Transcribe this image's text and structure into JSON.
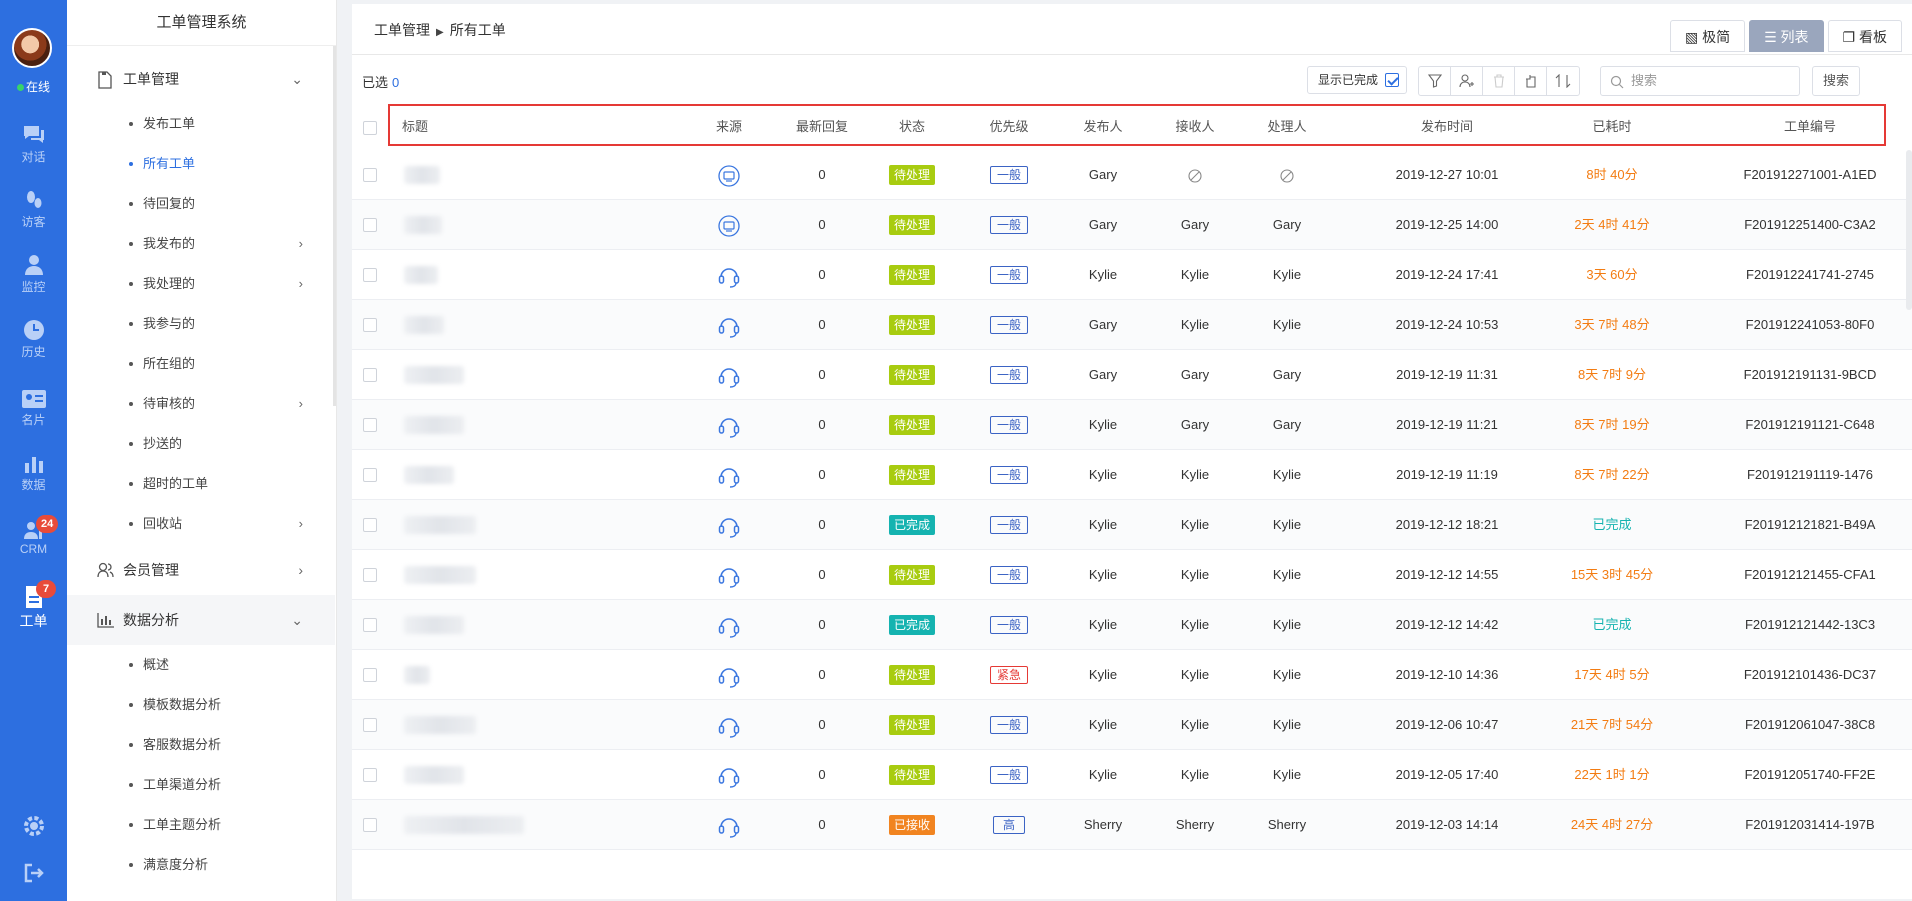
{
  "rail": {
    "online": "在线",
    "items": [
      {
        "label": "对话",
        "icon": "chat-icon"
      },
      {
        "label": "访客",
        "icon": "footprint-icon"
      },
      {
        "label": "监控",
        "icon": "monitor-person-icon"
      },
      {
        "label": "历史",
        "icon": "clock-icon"
      },
      {
        "label": "名片",
        "icon": "card-icon"
      },
      {
        "label": "数据",
        "icon": "bar-chart-icon"
      },
      {
        "label": "CRM",
        "icon": "crm-icon",
        "badge": "24"
      },
      {
        "label": "工单",
        "icon": "ticket-icon",
        "badge": "7"
      }
    ]
  },
  "nav": {
    "title": "工单管理系统",
    "ticket_group": "工单管理",
    "ticket_items": [
      "发布工单",
      "所有工单",
      "待回复的",
      "我发布的",
      "我处理的",
      "我参与的",
      "所在组的",
      "待审核的",
      "抄送的",
      "超时的工单",
      "回收站"
    ],
    "member_group": "会员管理",
    "analysis_group": "数据分析",
    "analysis_items": [
      "概述",
      "模板数据分析",
      "客服数据分析",
      "工单渠道分析",
      "工单主题分析",
      "满意度分析"
    ]
  },
  "header": {
    "breadcrumb_parent": "工单管理",
    "breadcrumb_current": "所有工单",
    "views": [
      "极简",
      "列表",
      "看板"
    ]
  },
  "toolbar": {
    "selected_label": "已选",
    "selected_count": "0",
    "show_done": "显示已完成",
    "search_placeholder": "搜索",
    "search_button": "搜索"
  },
  "columns": [
    "标题",
    "来源",
    "最新回复",
    "状态",
    "优先级",
    "发布人",
    "接收人",
    "处理人",
    "发布时间",
    "已耗时",
    "工单编号"
  ],
  "rows": [
    {
      "src": "web",
      "reply": "0",
      "status": "待处理",
      "prio": "一般",
      "pub": "Gary",
      "recv": "",
      "handler": "",
      "time": "2019-12-27 10:01",
      "elapsed": "8时 40分",
      "id": "F201912271001-A1ED"
    },
    {
      "src": "web",
      "reply": "0",
      "status": "待处理",
      "prio": "一般",
      "pub": "Gary",
      "recv": "Gary",
      "handler": "Gary",
      "time": "2019-12-25 14:00",
      "elapsed": "2天 4时 41分",
      "id": "F201912251400-C3A2"
    },
    {
      "src": "headset",
      "reply": "0",
      "status": "待处理",
      "prio": "一般",
      "pub": "Kylie",
      "recv": "Kylie",
      "handler": "Kylie",
      "time": "2019-12-24 17:41",
      "elapsed": "3天 60分",
      "id": "F201912241741-2745"
    },
    {
      "src": "headset",
      "reply": "0",
      "status": "待处理",
      "prio": "一般",
      "pub": "Gary",
      "recv": "Kylie",
      "handler": "Kylie",
      "time": "2019-12-24 10:53",
      "elapsed": "3天 7时 48分",
      "id": "F201912241053-80F0"
    },
    {
      "src": "headset",
      "reply": "0",
      "status": "待处理",
      "prio": "一般",
      "pub": "Gary",
      "recv": "Gary",
      "handler": "Gary",
      "time": "2019-12-19 11:31",
      "elapsed": "8天 7时 9分",
      "id": "F201912191131-9BCD"
    },
    {
      "src": "headset",
      "reply": "0",
      "status": "待处理",
      "prio": "一般",
      "pub": "Kylie",
      "recv": "Gary",
      "handler": "Gary",
      "time": "2019-12-19 11:21",
      "elapsed": "8天 7时 19分",
      "id": "F201912191121-C648"
    },
    {
      "src": "headset",
      "reply": "0",
      "status": "待处理",
      "prio": "一般",
      "pub": "Kylie",
      "recv": "Kylie",
      "handler": "Kylie",
      "time": "2019-12-19 11:19",
      "elapsed": "8天 7时 22分",
      "id": "F201912191119-1476"
    },
    {
      "src": "headset",
      "reply": "0",
      "status": "已完成",
      "prio": "一般",
      "pub": "Kylie",
      "recv": "Kylie",
      "handler": "Kylie",
      "time": "2019-12-12 18:21",
      "elapsed": "已完成",
      "id": "F201912121821-B49A"
    },
    {
      "src": "headset",
      "reply": "0",
      "status": "待处理",
      "prio": "一般",
      "pub": "Kylie",
      "recv": "Kylie",
      "handler": "Kylie",
      "time": "2019-12-12 14:55",
      "elapsed": "15天 3时 45分",
      "id": "F201912121455-CFA1"
    },
    {
      "src": "headset",
      "reply": "0",
      "status": "已完成",
      "prio": "一般",
      "pub": "Kylie",
      "recv": "Kylie",
      "handler": "Kylie",
      "time": "2019-12-12 14:42",
      "elapsed": "已完成",
      "id": "F201912121442-13C3"
    },
    {
      "src": "headset",
      "reply": "0",
      "status": "待处理",
      "prio": "紧急",
      "pub": "Kylie",
      "recv": "Kylie",
      "handler": "Kylie",
      "time": "2019-12-10 14:36",
      "elapsed": "17天 4时 5分",
      "id": "F201912101436-DC37"
    },
    {
      "src": "headset",
      "reply": "0",
      "status": "待处理",
      "prio": "一般",
      "pub": "Kylie",
      "recv": "Kylie",
      "handler": "Kylie",
      "time": "2019-12-06 10:47",
      "elapsed": "21天 7时 54分",
      "id": "F201912061047-38C8"
    },
    {
      "src": "headset",
      "reply": "0",
      "status": "待处理",
      "prio": "一般",
      "pub": "Kylie",
      "recv": "Kylie",
      "handler": "Kylie",
      "time": "2019-12-05 17:40",
      "elapsed": "22天 1时 1分",
      "id": "F201912051740-FF2E"
    },
    {
      "src": "headset",
      "reply": "0",
      "status": "已接收",
      "prio": "高",
      "pub": "Sherry",
      "recv": "Sherry",
      "handler": "Sherry",
      "time": "2019-12-03 14:14",
      "elapsed": "24天 4时 27分",
      "id": "F201912031414-197B"
    }
  ],
  "colors": {
    "accent": "#2d6fe0",
    "pending": "#a8cc10",
    "done": "#15b3b0",
    "received": "#f18420",
    "elapsed": "#f37c12",
    "highlight_box": "#e53935"
  }
}
